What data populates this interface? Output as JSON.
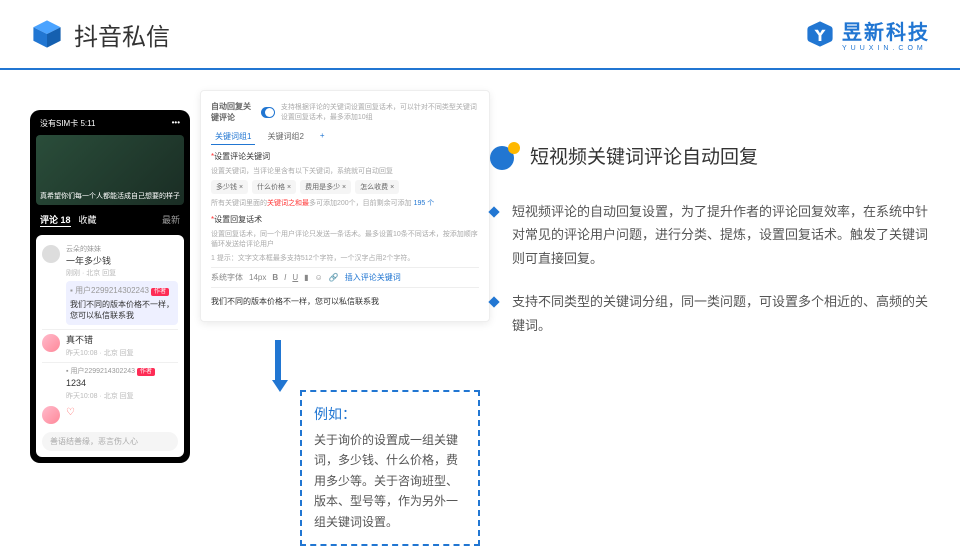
{
  "header": {
    "title": "抖音私信",
    "brand": "昱新科技",
    "brand_sub": "YUUXIN.COM"
  },
  "section": {
    "title": "短视频关键词评论自动回复",
    "bullets": [
      "短视频评论的自动回复设置，为了提升作者的评论回复效率，在系统中针对常见的评论用户问题，进行分类、提炼，设置回复话术。触发了关键词则可直接回复。",
      "支持不同类型的关键词分组，同一类问题，可设置多个相近的、高频的关键词。"
    ]
  },
  "example": {
    "title": "例如：",
    "body": "关于询价的设置成一组关键词，多少钱、什么价格，费用多少等。关于咨询班型、版本、型号等，作为另外一组关键词设置。"
  },
  "panel": {
    "toggle_label": "自动回复关键评论",
    "toggle_hint": "支持根据评论的关键词设置回复话术，可以针对不同类型关键词设置回复话术，最多添加10组",
    "tabs": [
      "关键词组1",
      "关键词组2"
    ],
    "plus": "+",
    "kw_label": "设置评论关键词",
    "kw_hint": "设置关键词，当评论里含有以下关键词，系统就可自动回复",
    "chips": [
      "多少钱 ×",
      "什么价格 ×",
      "费用是多少 ×",
      "怎么收费 ×"
    ],
    "kw_note_a": "所有关键词里面的",
    "kw_note_red": "关键词之和最",
    "kw_note_b": "多可添加200个，目前剩余可添加 ",
    "kw_note_num": "195 个",
    "reply_label": "设置回复话术",
    "reply_hint": "设置回复话术，同一个用户评论只发送一条话术。最多设置10条不同话术，按添加顺序循环发送给评论用户",
    "reply_rule": "1 提示：文字文本框最多支持512个字符，一个汉字占用2个字符。",
    "font": "系统字体",
    "size": "14px",
    "insert": "插入评论关键词",
    "editor_text": "我们不同的版本价格不一样，您可以私信联系我"
  },
  "phone": {
    "status": "没有SIM卡 5:11",
    "vid_caption": "真希望你们每一个人都能活成自己想要的样子",
    "tab1": "评论 18",
    "tab2": "收藏",
    "tab3": "最新",
    "c1_name": "云朵的妹妹",
    "c1_text": "一年多少钱",
    "c1_meta": "刚刚 · 北京 回复",
    "c2_name": "用户2299214302243",
    "c2_badge": "作者",
    "c2_text": "我们不同的版本价格不一样，您可以私信联系我",
    "c3_text": "真不错",
    "c3_meta": "昨天10:08 · 北京 回复",
    "c4_name": "用户2299214302243",
    "c4_badge": "作者",
    "c4_text": "1234",
    "c4_meta": "昨天10:08 · 北京 回复",
    "input": "善语结善缘，恶言伤人心"
  }
}
